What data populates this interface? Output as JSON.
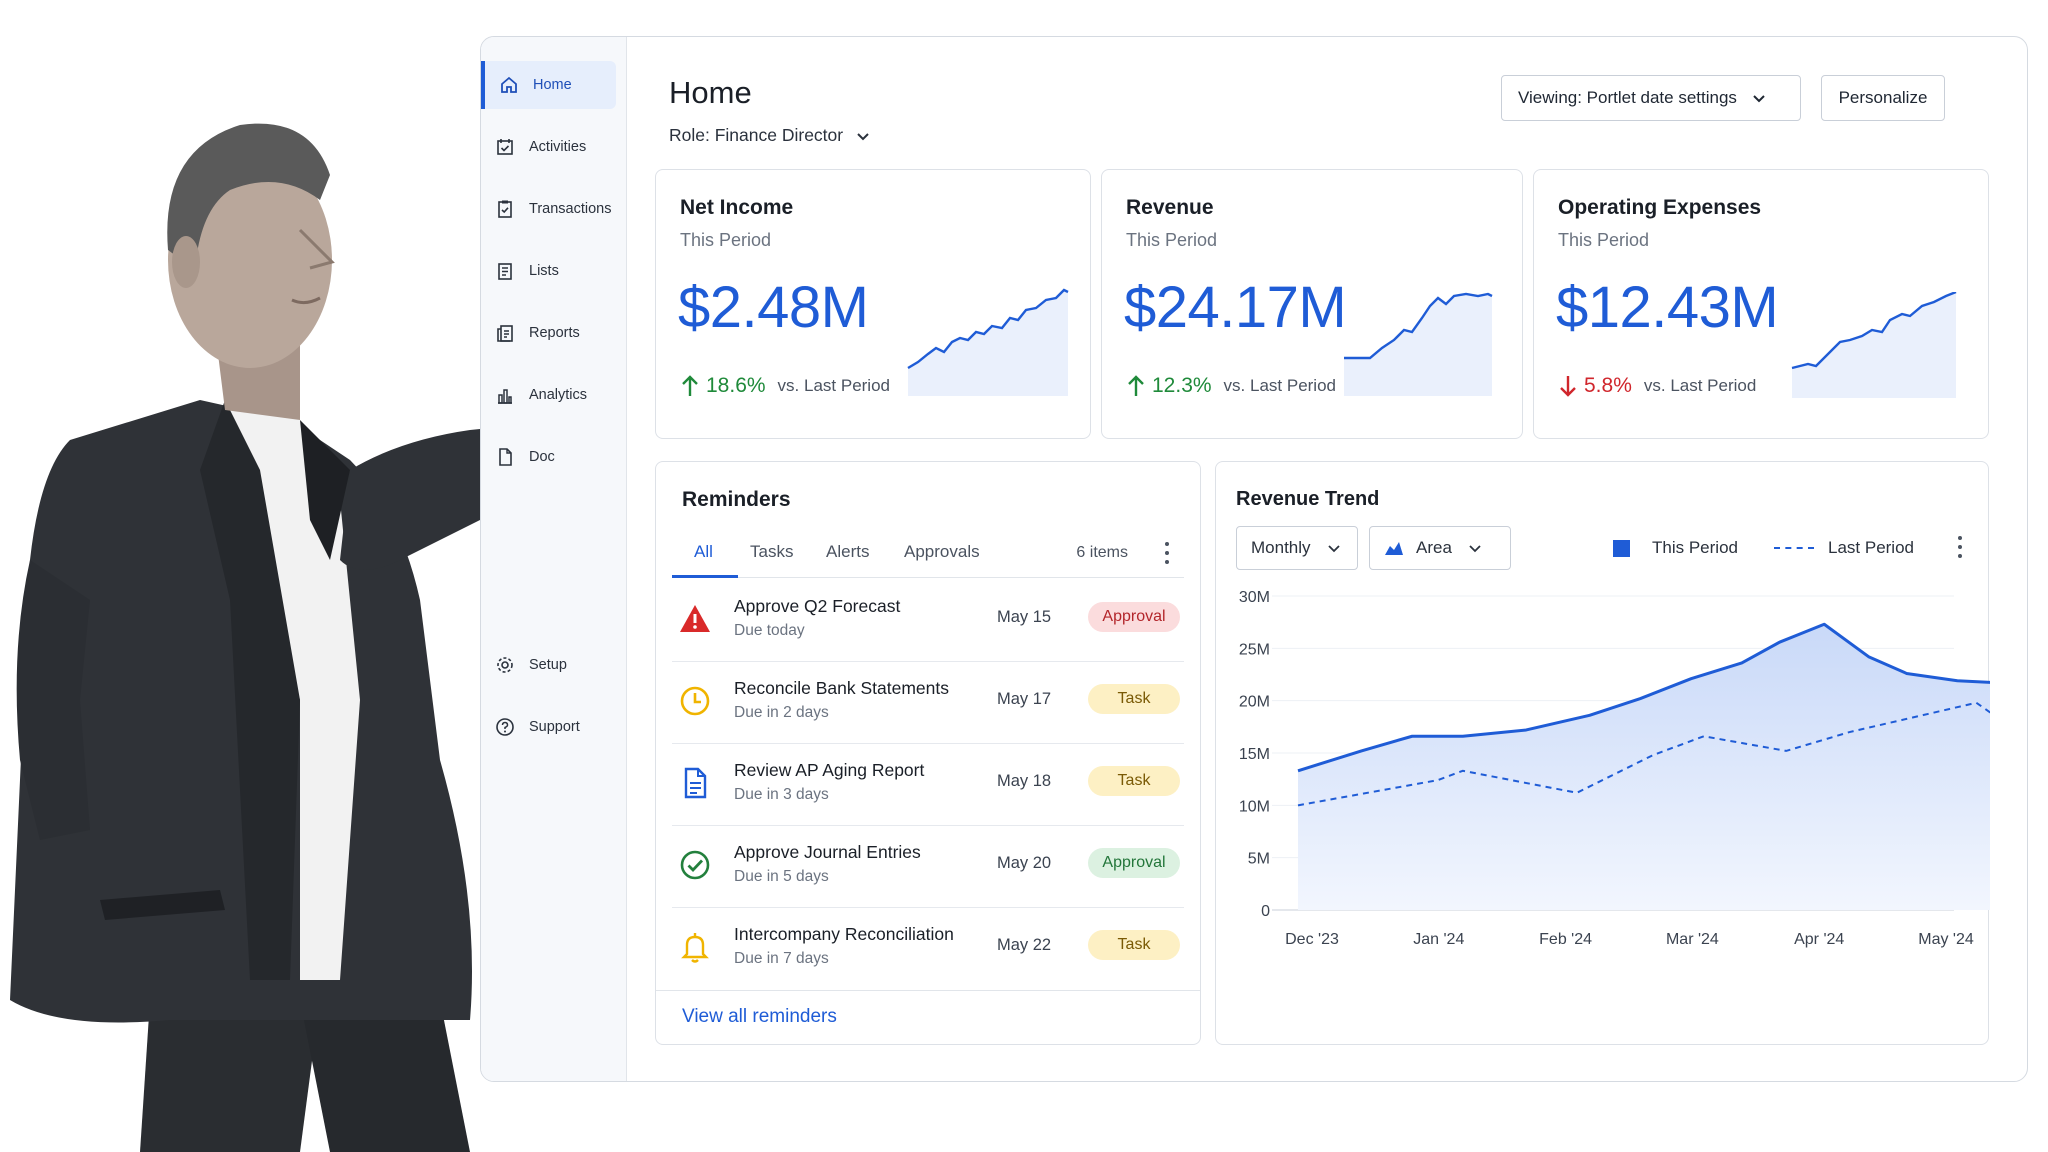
{
  "sidebar": {
    "items": [
      {
        "label": "Home",
        "icon": "home-icon"
      },
      {
        "label": "Activities",
        "icon": "calendar-check-icon"
      },
      {
        "label": "Transactions",
        "icon": "clipboard-check-icon"
      },
      {
        "label": "Lists",
        "icon": "list-icon"
      },
      {
        "label": "Reports",
        "icon": "report-icon"
      },
      {
        "label": "Analytics",
        "icon": "bar-chart-icon"
      },
      {
        "label": "Doc",
        "icon": "document-icon"
      },
      {
        "label": "Setup",
        "icon": "gear-icon"
      },
      {
        "label": "Support",
        "icon": "help-circle-icon"
      }
    ]
  },
  "header": {
    "title": "Home",
    "role": "Role: Finance Director",
    "viewing": "Viewing: Portlet date settings",
    "personalize": "Personalize"
  },
  "kpis": [
    {
      "title": "Net Income",
      "sub": "This Period",
      "value": "$2.48M",
      "delta": "18.6%",
      "direction": "up",
      "compare": "vs. Last Period"
    },
    {
      "title": "Revenue",
      "sub": "This Period",
      "value": "$24.17M",
      "delta": "12.3%",
      "direction": "up",
      "compare": "vs. Last Period"
    },
    {
      "title": "Operating Expenses",
      "sub": "This Period",
      "value": "$12.43M",
      "delta": "5.8%",
      "direction": "down",
      "compare": "vs. Last Period"
    }
  ],
  "reminders": {
    "title": "Reminders",
    "tabs": [
      "All",
      "Tasks",
      "Alerts",
      "Approvals"
    ],
    "count": "6 items",
    "items": [
      {
        "title": "Approve Q2 Forecast",
        "due": "Due today",
        "date": "May 15",
        "badge": "Approval",
        "icon": "warning-triangle-icon"
      },
      {
        "title": "Reconcile Bank Statements",
        "due": "Due in 2 days",
        "date": "May 17",
        "badge": "Task",
        "icon": "clock-icon"
      },
      {
        "title": "Review AP Aging Report",
        "due": "Due in 3 days",
        "date": "May 18",
        "badge": "Task",
        "icon": "document-icon"
      },
      {
        "title": "Approve Journal Entries",
        "due": "Due in 5 days",
        "date": "May 20",
        "badge": "Approval",
        "icon": "check-circle-icon"
      },
      {
        "title": "Intercompany Reconciliation",
        "due": "Due in 7 days",
        "date": "May 22",
        "badge": "Task",
        "icon": "bell-icon"
      }
    ],
    "view_all": "View all reminders"
  },
  "trend": {
    "title": "Revenue Trend",
    "period_select": "Monthly",
    "type_select": "Area",
    "legend_this": "This Period",
    "legend_last": "Last Period"
  },
  "colors": {
    "accent": "#1f5cd6",
    "up": "#1f8a3a",
    "down": "#d0262c"
  },
  "chart_data": {
    "type": "area",
    "title": "Revenue Trend",
    "x": [
      "Dec '23",
      "Jan '24",
      "Feb '24",
      "Mar '24",
      "Apr '24",
      "May '24"
    ],
    "y_ticks": [
      "0",
      "5M",
      "10M",
      "15M",
      "20M",
      "25M",
      "30M"
    ],
    "ylim": [
      0,
      30
    ],
    "grid": true,
    "legend_position": "top-right",
    "series": [
      {
        "name": "This Period",
        "style": "solid-area",
        "points": [
          [
            0,
            13.3
          ],
          [
            0.5,
            15.2
          ],
          [
            0.9,
            16.6
          ],
          [
            1.3,
            16.6
          ],
          [
            1.8,
            17.2
          ],
          [
            2.3,
            18.6
          ],
          [
            2.7,
            20.2
          ],
          [
            3.1,
            22.1
          ],
          [
            3.5,
            23.6
          ],
          [
            3.8,
            25.6
          ],
          [
            4.15,
            27.3
          ],
          [
            4.5,
            24.2
          ],
          [
            4.8,
            22.6
          ],
          [
            5.2,
            21.9
          ],
          [
            5.55,
            21.7
          ]
        ]
      },
      {
        "name": "Last Period",
        "style": "dashed",
        "points": [
          [
            0,
            10.0
          ],
          [
            1.1,
            12.4
          ],
          [
            1.3,
            13.3
          ],
          [
            2.2,
            11.2
          ],
          [
            2.8,
            14.8
          ],
          [
            3.2,
            16.6
          ],
          [
            3.85,
            15.2
          ],
          [
            4.35,
            17.0
          ],
          [
            5.35,
            19.8
          ],
          [
            5.55,
            18.1
          ]
        ]
      }
    ]
  }
}
